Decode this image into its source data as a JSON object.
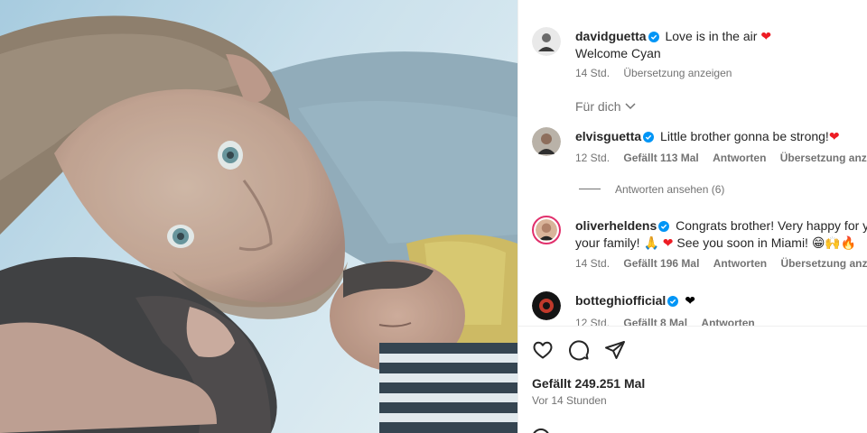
{
  "post": {
    "author": "davidguetta",
    "caption_line1": "Love is in the air",
    "caption_line2": "Welcome Cyan",
    "age": "14 Std.",
    "translate": "Übersetzung anzeigen",
    "sort_label": "Für dich"
  },
  "comments": [
    {
      "user": "elvisguetta",
      "text": "Little brother gonna be strong!",
      "age": "12 Std.",
      "likes": "Gefällt 113 Mal",
      "reply": "Antworten",
      "translate": "Übersetzung anzeigen"
    },
    {
      "user": "oliverheldens",
      "text": "Congrats brother! Very happy for you",
      "text2": "your family! 🙏",
      "text3": "See you soon in Miami! 😁🙌🔥",
      "age": "14 Std.",
      "likes": "Gefällt 196 Mal",
      "reply": "Antworten",
      "translate": "Übersetzung anzeigen"
    },
    {
      "user": "botteghiofficial",
      "age": "12 Std.",
      "likes": "Gefällt 8 Mal",
      "reply": "Antworten"
    }
  ],
  "view_replies": "Antworten ansehen (6)",
  "footer": {
    "likes": "Gefällt 249.251 Mal",
    "time": "Vor 14 Stunden"
  },
  "icons": {
    "like": "heart-outline-icon",
    "comment": "comment-bubble-icon",
    "share": "paper-plane-icon",
    "verified": "verified-badge-icon"
  },
  "colors": {
    "verified": "#0095f6",
    "heart": "#ed1c24",
    "muted": "#737373"
  }
}
